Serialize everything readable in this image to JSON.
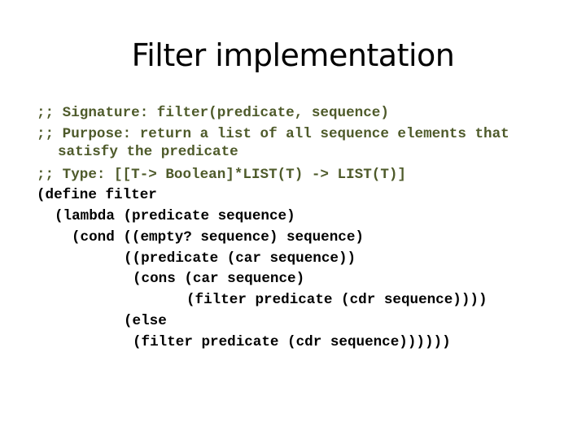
{
  "slide": {
    "title": "Filter implementation",
    "colors": {
      "comment": "#4e5a2a",
      "code": "#000000",
      "background": "#ffffff"
    },
    "lines": [
      {
        "kind": "comment",
        "text": ";; Signature: filter(predicate, sequence)"
      },
      {
        "kind": "comment",
        "text": ";; Purpose: return a list of all sequence elements that"
      },
      {
        "kind": "comment",
        "text": "satisfy the predicate"
      },
      {
        "kind": "comment",
        "text": ";; Type: [[T-> Boolean]*LIST(T) -> LIST(T)]"
      },
      {
        "kind": "code",
        "text": "(define filter"
      },
      {
        "kind": "code",
        "text": "(lambda (predicate sequence)"
      },
      {
        "kind": "code",
        "text": "(cond ((empty? sequence) sequence)"
      },
      {
        "kind": "code",
        "text": "((predicate (car sequence))"
      },
      {
        "kind": "code",
        "text": "(cons (car sequence)"
      },
      {
        "kind": "code",
        "text": "(filter predicate (cdr sequence))))"
      },
      {
        "kind": "code",
        "text": "(else"
      },
      {
        "kind": "code",
        "text": "(filter predicate (cdr sequence))))))"
      }
    ]
  }
}
